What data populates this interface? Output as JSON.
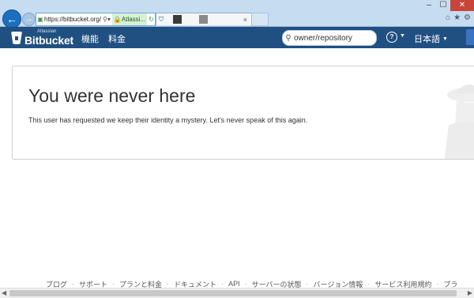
{
  "browser": {
    "address_url": "https://bitbucket.org/",
    "address_site": "Atlassi...",
    "tab_close": "×"
  },
  "header": {
    "logo_sub": "Atlassian",
    "logo_text": "Bitbucket",
    "nav_features": "機能",
    "nav_pricing": "料金",
    "search_value": "owner/repository",
    "help_symbol": "?",
    "language": "日本語"
  },
  "main": {
    "title": "You were never here",
    "description": "This user has requested we keep their identity a mystery. Let's never speak of this again."
  },
  "footer": {
    "links": [
      "ブログ",
      "サポート",
      "プランと料金",
      "ドキュメント",
      "API",
      "サーバーの状態",
      "バージョン情報",
      "サービス利用規約",
      "プラ"
    ]
  },
  "colors": {
    "header_bg": "#205081",
    "chrome_bg": "#c6dcf0",
    "close_button": "#c7453a"
  }
}
